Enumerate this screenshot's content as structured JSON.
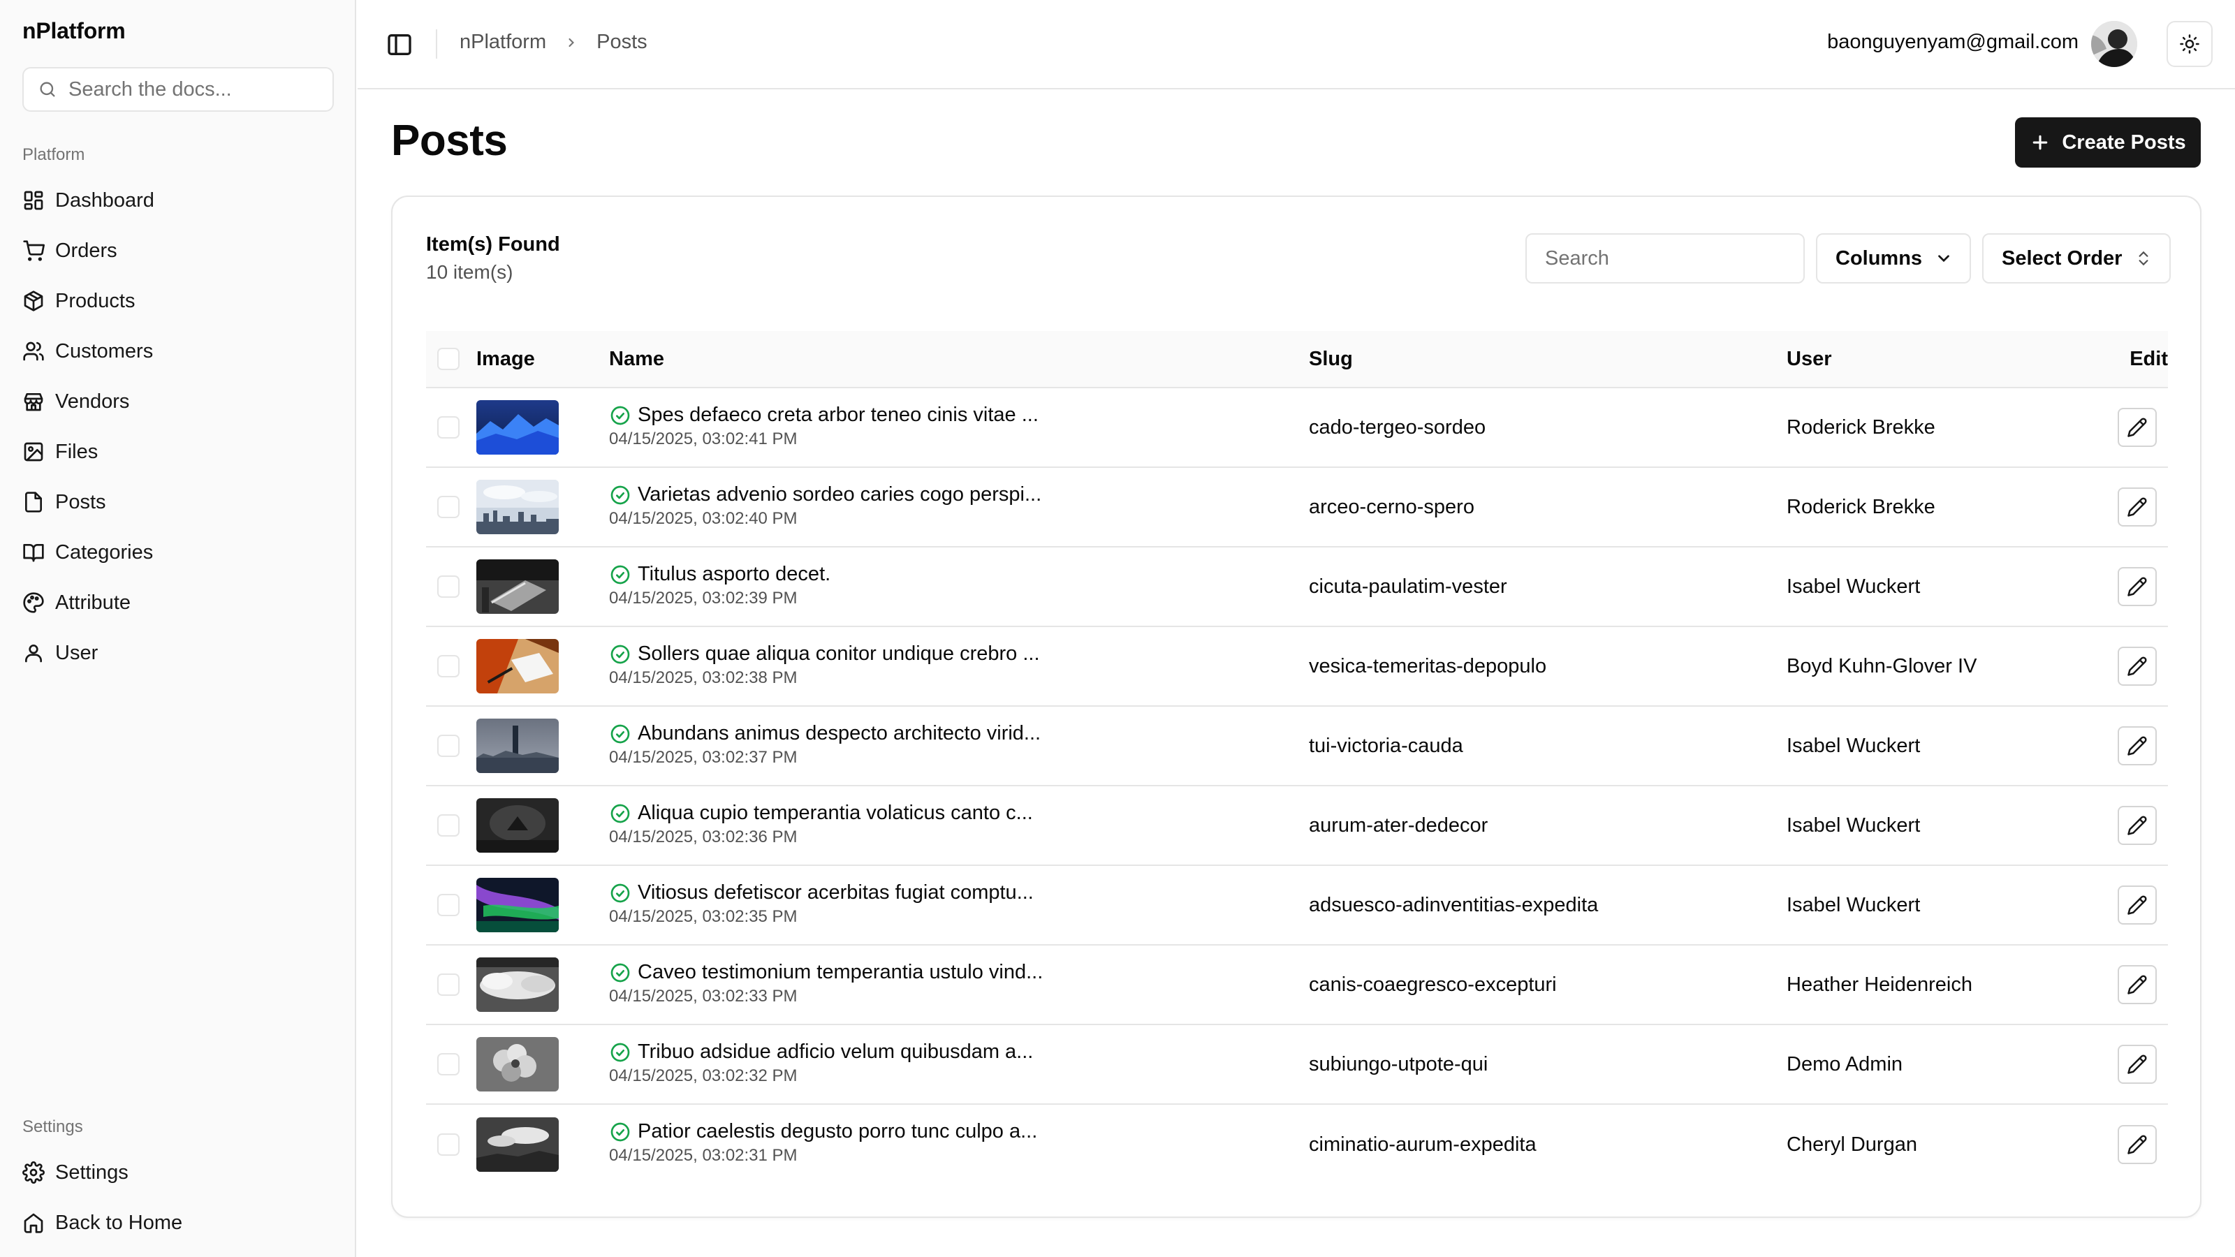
{
  "sidebar": {
    "brand": "nPlatform",
    "search_placeholder": "Search the docs...",
    "platform_label": "Platform",
    "items": [
      {
        "label": "Dashboard",
        "icon": "layout-dashboard-icon"
      },
      {
        "label": "Orders",
        "icon": "shopping-cart-icon"
      },
      {
        "label": "Products",
        "icon": "package-icon"
      },
      {
        "label": "Customers",
        "icon": "users-icon"
      },
      {
        "label": "Vendors",
        "icon": "store-icon"
      },
      {
        "label": "Files",
        "icon": "image-icon"
      },
      {
        "label": "Posts",
        "icon": "file-icon"
      },
      {
        "label": "Categories",
        "icon": "book-open-icon"
      },
      {
        "label": "Attribute",
        "icon": "palette-icon"
      },
      {
        "label": "User",
        "icon": "user-icon"
      }
    ],
    "settings_label": "Settings",
    "settings_items": [
      {
        "label": "Settings",
        "icon": "gear-icon"
      },
      {
        "label": "Back to Home",
        "icon": "home-icon"
      }
    ]
  },
  "header": {
    "breadcrumb": [
      "nPlatform",
      "Posts"
    ],
    "user_email": "baonguyenyam@gmail.com"
  },
  "main": {
    "title": "Posts",
    "create_label": "Create Posts",
    "found_title": "Item(s) Found",
    "found_count": "10 item(s)",
    "search_placeholder": "Search",
    "columns_label": "Columns",
    "order_label": "Select Order",
    "table_headers": {
      "image": "Image",
      "name": "Name",
      "slug": "Slug",
      "user": "User",
      "edit": "Edit"
    },
    "rows": [
      {
        "name": "Spes defaeco creta arbor teneo cinis vitae ...",
        "date": "04/15/2025, 03:02:41 PM",
        "slug": "cado-tergeo-sordeo",
        "user": "Roderick Brekke",
        "thumb": "mountain-lake"
      },
      {
        "name": "Varietas advenio sordeo caries cogo perspi...",
        "date": "04/15/2025, 03:02:40 PM",
        "slug": "arceo-cerno-spero",
        "user": "Roderick Brekke",
        "thumb": "city-skyline"
      },
      {
        "name": "Titulus asporto decet.",
        "date": "04/15/2025, 03:02:39 PM",
        "slug": "cicuta-paulatim-vester",
        "user": "Isabel Wuckert",
        "thumb": "bw-bench"
      },
      {
        "name": "Sollers quae aliqua conitor undique crebro ...",
        "date": "04/15/2025, 03:02:38 PM",
        "slug": "vesica-temeritas-depopulo",
        "user": "Boyd Kuhn-Glover IV",
        "thumb": "desk-wood"
      },
      {
        "name": "Abundans animus despecto architecto virid...",
        "date": "04/15/2025, 03:02:37 PM",
        "slug": "tui-victoria-cauda",
        "user": "Isabel Wuckert",
        "thumb": "tower-city"
      },
      {
        "name": "Aliqua cupio temperantia volaticus canto c...",
        "date": "04/15/2025, 03:02:36 PM",
        "slug": "aurum-ater-dedecor",
        "user": "Isabel Wuckert",
        "thumb": "dark-bw"
      },
      {
        "name": "Vitiosus defetiscor acerbitas fugiat comptu...",
        "date": "04/15/2025, 03:02:35 PM",
        "slug": "adsuesco-adinventitias-expedita",
        "user": "Isabel Wuckert",
        "thumb": "aurora"
      },
      {
        "name": "Caveo testimonium temperantia ustulo vind...",
        "date": "04/15/2025, 03:02:33 PM",
        "slug": "canis-coaegresco-excepturi",
        "user": "Heather Heidenreich",
        "thumb": "bw-clouds"
      },
      {
        "name": "Tribuo adsidue adficio velum quibusdam a...",
        "date": "04/15/2025, 03:02:32 PM",
        "slug": "subiungo-utpote-qui",
        "user": "Demo Admin",
        "thumb": "bw-flower"
      },
      {
        "name": "Patior caelestis degusto porro tunc culpo a...",
        "date": "04/15/2025, 03:02:31 PM",
        "slug": "ciminatio-aurum-expedita",
        "user": "Cheryl Durgan",
        "thumb": "bw-sky"
      }
    ]
  },
  "colors": {
    "primary": "#171717",
    "border": "#e5e5e5",
    "muted": "#737373",
    "success": "#16a34a"
  }
}
